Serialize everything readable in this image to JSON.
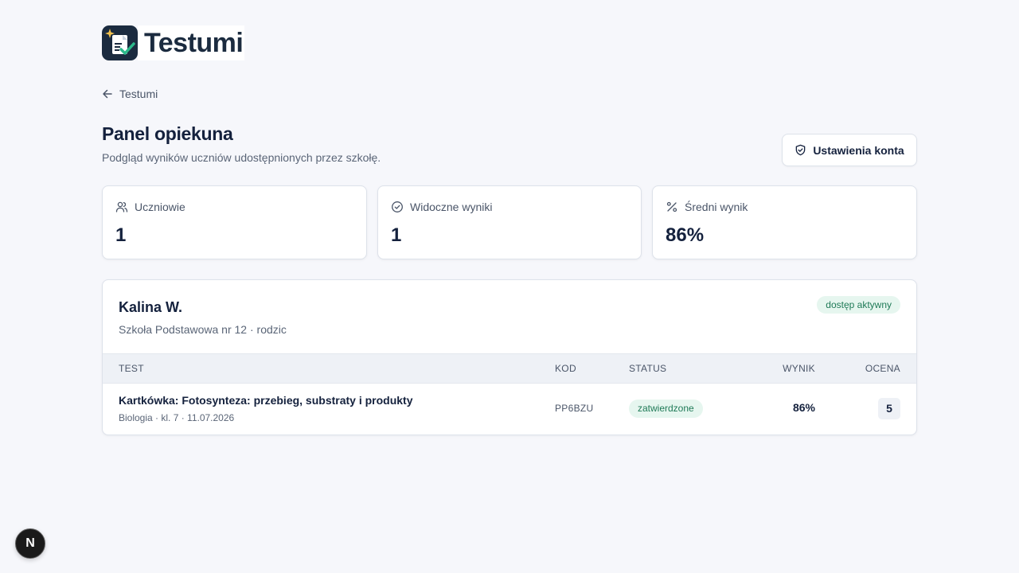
{
  "brand": {
    "name": "Testumi"
  },
  "nav": {
    "back_label": "Testumi"
  },
  "header": {
    "title": "Panel opiekuna",
    "subtitle": "Podgląd wyników uczniów udostępnionych przez szkołę.",
    "settings_label": "Ustawienia konta"
  },
  "stats": [
    {
      "label": "Uczniowie",
      "value": "1",
      "icon": "users-icon"
    },
    {
      "label": "Widoczne wyniki",
      "value": "1",
      "icon": "check-circle-icon"
    },
    {
      "label": "Średni wynik",
      "value": "86%",
      "icon": "percent-icon"
    }
  ],
  "student": {
    "name": "Kalina W.",
    "meta": "Szkoła Podstawowa nr 12 · rodzic",
    "access_badge": "dostęp aktywny",
    "columns": {
      "test": "TEST",
      "code": "KOD",
      "status": "STATUS",
      "score": "WYNIK",
      "grade": "OCENA"
    },
    "rows": [
      {
        "title": "Kartkówka: Fotosynteza: przebieg, substraty i produkty",
        "subtitle": "Biologia · kl. 7 · 11.07.2026",
        "code": "PP6BZU",
        "status": "zatwierdzone",
        "score": "86%",
        "grade": "5"
      }
    ]
  },
  "dev_indicator": {
    "letter": "N"
  },
  "colors": {
    "accent": "#1b2b3f",
    "success_bg": "#e6f6ef",
    "success_text": "#1f7a57",
    "background": "#f6f7fb"
  }
}
